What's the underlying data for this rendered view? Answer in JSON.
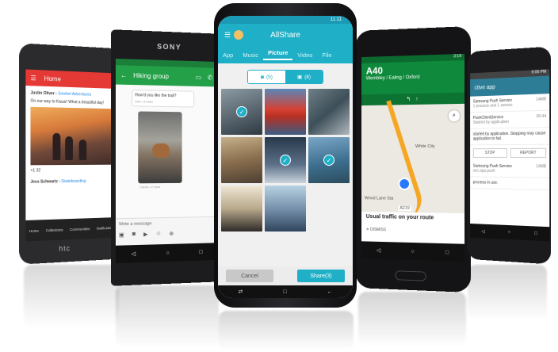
{
  "htc": {
    "title": "Home",
    "author": "Justin Oliver",
    "group": "Snorkel Adventures",
    "post": "On our way to Kauai! What a beautiful day!",
    "likes": "32",
    "author2": "Jess Schwartz",
    "group2": "Skateboarding",
    "nav": [
      "Home",
      "Collections",
      "Communities",
      "Notifications"
    ],
    "brand": "htc"
  },
  "sony": {
    "brand": "SONY",
    "title": "Hiking group",
    "msg1": "How'd you like the trail?",
    "msg1_meta": "Dan • 5 mins",
    "img_meta": "Carrie • 2 mins",
    "input_placeholder": "Write a message"
  },
  "allshare": {
    "time": "11:11",
    "title": "AllShare",
    "tabs": [
      "App",
      "Music",
      "Picture",
      "Video",
      "File"
    ],
    "active_tab": "Picture",
    "toggle_left": "(5)",
    "toggle_right": "(8)",
    "cancel": "Cancel",
    "share": "Share(3)"
  },
  "maps": {
    "time": "3:19",
    "road": "A40",
    "sub": "Wembley / Ealing / Oxford",
    "label1": "White City",
    "label2": "Wood Lane Sta",
    "label3": "A219",
    "panel_title": "Usual traffic on your route",
    "dismiss": "DISMISS"
  },
  "right": {
    "time": "6:06 PM",
    "title": "ctive app",
    "row1": "Samsung Push Service",
    "row1_sub": "1 process and 1 service",
    "row1_size": "14MB",
    "row2": "PushClientService",
    "row2_sub": "Started by application",
    "row2_time": "00:44",
    "desc": "started by application. Stopping may cause application to fail.",
    "stop": "STOP",
    "report": "REPORT",
    "row3": "Samsung Push Service",
    "row3_sub": "sec.app.push",
    "row3_size": "14MB",
    "row4": "process in use."
  }
}
